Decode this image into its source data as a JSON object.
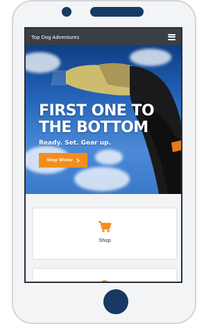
{
  "colors": {
    "device_body": "#f3f4f6",
    "device_accent": "#163a63",
    "header_bg": "#3a3f45",
    "hero_sky": "#2563b8",
    "cta_orange": "#f28d1c",
    "icon_orange": "#f28d1c",
    "card_bg": "#ffffff",
    "page_bg": "#f2f3f5"
  },
  "header": {
    "site_title": "Top Dog Adventures",
    "menu_icon": "hamburger-menu-icon"
  },
  "hero": {
    "headline_line1": "FIRST ONE TO",
    "headline_line2": "THE BOTTOM",
    "subtitle": "Ready. Set. Gear up.",
    "cta_label": "Shop Winter",
    "cta_icon": "chevron-right-icon",
    "carousel_slides": 2,
    "active_slide": 1
  },
  "cards": [
    {
      "label": "Shop",
      "icon": "shopping-cart-icon"
    },
    {
      "label": "",
      "icon": "partial-orange-icon"
    }
  ]
}
